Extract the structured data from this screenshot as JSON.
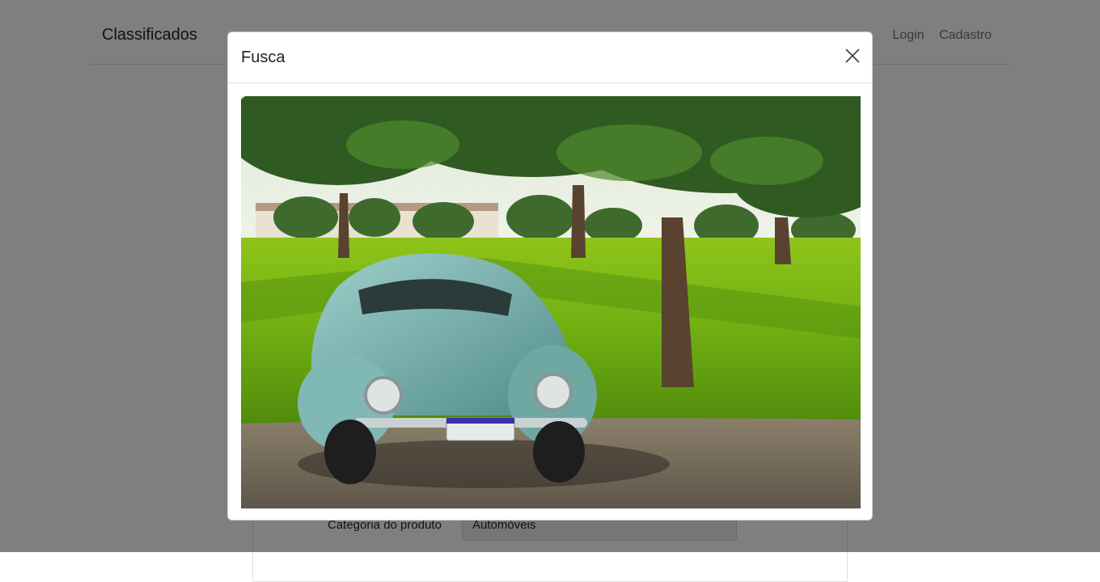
{
  "navbar": {
    "brand": "Classificados",
    "links": [
      "Login",
      "Cadastro"
    ]
  },
  "form": {
    "category_label": "Categoria do produto",
    "category_value": "Automóveis"
  },
  "modal": {
    "title": "Fusca",
    "close_icon": "close-icon",
    "image_subject": "car-photo"
  }
}
